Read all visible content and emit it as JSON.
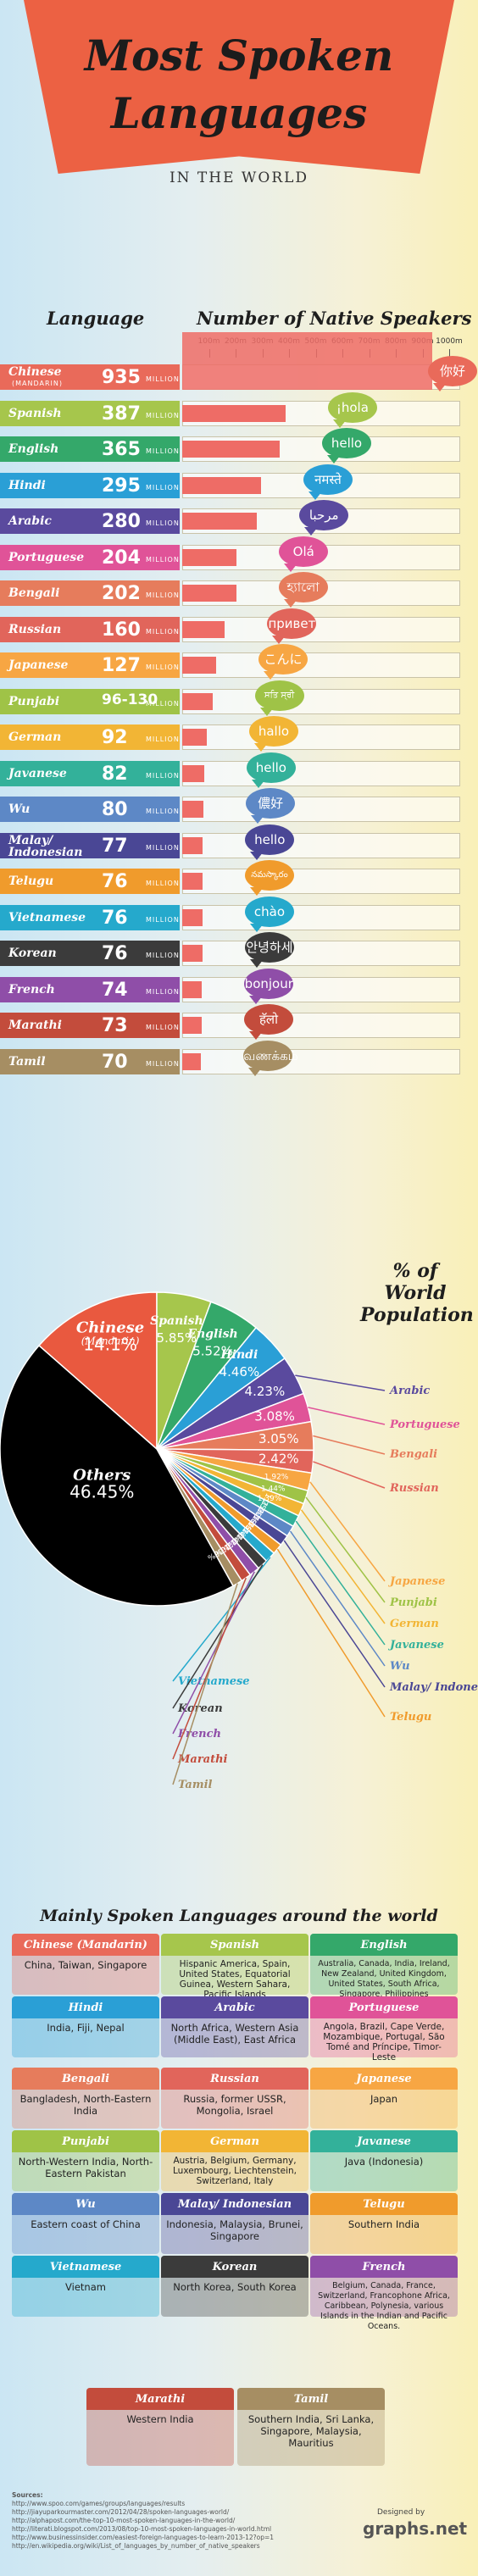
{
  "header": {
    "title_line1": "Most Spoken",
    "title_line2": "Languages",
    "subtitle": "IN THE WORLD",
    "col_language": "Language",
    "col_speakers": "Number of Native Speakers"
  },
  "colors": {
    "banner": "#ec6143",
    "bar": "#ee6c66",
    "pie_others": "#000000"
  },
  "chart_data": [
    {
      "type": "bar",
      "title": "Number of Native Speakers",
      "unit": "MILLION",
      "ticks": [
        "100m",
        "200m",
        "300m",
        "400m",
        "500m",
        "600m",
        "700m",
        "800m",
        "900m",
        "1000m"
      ],
      "xlim": [
        0,
        1000
      ],
      "categories": [
        "Chinese (MANDARIN)",
        "Spanish",
        "English",
        "Hindi",
        "Arabic",
        "Portuguese",
        "Bengali",
        "Russian",
        "Japanese",
        "Punjabi",
        "German",
        "Javanese",
        "Wu",
        "Malay/ Indonesian",
        "Telugu",
        "Vietnamese",
        "Korean",
        "French",
        "Marathi",
        "Tamil"
      ],
      "labels": [
        "935",
        "387",
        "365",
        "295",
        "280",
        "204",
        "202",
        "160",
        "127",
        "96-130",
        "92",
        "82",
        "80",
        "77",
        "76",
        "76",
        "76",
        "74",
        "73",
        "70"
      ],
      "values": [
        935,
        387,
        365,
        295,
        280,
        204,
        202,
        160,
        127,
        113,
        92,
        82,
        80,
        77,
        76,
        76,
        76,
        74,
        73,
        70
      ],
      "row_colors": [
        "#e96a5a",
        "#a6c64c",
        "#34a86a",
        "#2a9fd6",
        "#5a4a9e",
        "#e05398",
        "#e67c5c",
        "#e1655b",
        "#f7a643",
        "#9fc347",
        "#f2b535",
        "#33b19a",
        "#5d88c6",
        "#4a4795",
        "#f09b2c",
        "#25a9cc",
        "#3b3b3b",
        "#8f4ea8",
        "#c34c3c",
        "#a68e63"
      ],
      "greetings": [
        "你好",
        "¡hola",
        "hello",
        "नमस्ते",
        "مرحبا",
        "Olá",
        "হ্যালো",
        "привет",
        "こんにちは",
        "ਸਤਿ ਸ੍ਰੀ ਅਕਾਲ",
        "hallo",
        "hello",
        "儂好",
        "hello",
        "నమస్కారం",
        "chào",
        "안녕하세요",
        "bonjour",
        "हॅलो",
        "வணக்கம்"
      ],
      "bubble_colors": [
        "#e96a5a",
        "#a6c64c",
        "#34a86a",
        "#2a9fd6",
        "#5a4a9e",
        "#e05398",
        "#e67c5c",
        "#e1655b",
        "#f7a643",
        "#9fc347",
        "#f2b535",
        "#33b19a",
        "#5d88c6",
        "#4a4795",
        "#f09b2c",
        "#25a9cc",
        "#3b3b3b",
        "#8f4ea8",
        "#c34c3c",
        "#a68e63"
      ]
    },
    {
      "type": "pie",
      "title": "% of World Population",
      "slices": [
        {
          "name": "Chinese (Mandarin)",
          "pct": "14.1%",
          "value": 14.1,
          "color": "#e9593f"
        },
        {
          "name": "Spanish",
          "pct": "5.85%",
          "value": 5.85,
          "color": "#a6c64c"
        },
        {
          "name": "English",
          "pct": "5.52%",
          "value": 5.52,
          "color": "#34a86a"
        },
        {
          "name": "Hindi",
          "pct": "4.46%",
          "value": 4.46,
          "color": "#2a9fd6"
        },
        {
          "name": "Arabic",
          "pct": "4.23%",
          "value": 4.23,
          "color": "#5a4a9e"
        },
        {
          "name": "Portuguese",
          "pct": "3.08%",
          "value": 3.08,
          "color": "#e05398"
        },
        {
          "name": "Bengali",
          "pct": "3.05%",
          "value": 3.05,
          "color": "#e67c5c"
        },
        {
          "name": "Russian",
          "pct": "2.42%",
          "value": 2.42,
          "color": "#e1655b"
        },
        {
          "name": "Japanese",
          "pct": "1.92%",
          "value": 1.92,
          "color": "#f7a643"
        },
        {
          "name": "Punjabi",
          "pct": "1.44%",
          "value": 1.44,
          "color": "#9fc347"
        },
        {
          "name": "German",
          "pct": "1.39%",
          "value": 1.39,
          "color": "#f2b535"
        },
        {
          "name": "Javanese",
          "pct": "1.25%",
          "value": 1.25,
          "color": "#33b19a"
        },
        {
          "name": "Wu",
          "pct": "1.20%",
          "value": 1.2,
          "color": "#5d88c6"
        },
        {
          "name": "Malay/ Indonesian",
          "pct": "1.16%",
          "value": 1.16,
          "color": "#4a4795"
        },
        {
          "name": "Telugu",
          "pct": "1.15%",
          "value": 1.15,
          "color": "#f09b2c"
        },
        {
          "name": "Vietnamese",
          "pct": "1.14%",
          "value": 1.14,
          "color": "#25a9cc"
        },
        {
          "name": "Korean",
          "pct": "1.14%",
          "value": 1.14,
          "color": "#3b3b3b"
        },
        {
          "name": "French",
          "pct": "1.12%",
          "value": 1.12,
          "color": "#8f4ea8"
        },
        {
          "name": "Marathi",
          "pct": "1.10%",
          "value": 1.1,
          "color": "#c34c3c"
        },
        {
          "name": "Tamil",
          "pct": "1.06%",
          "value": 1.06,
          "color": "#a68e63"
        },
        {
          "name": "Others",
          "pct": "46.45%",
          "value": 46.45,
          "color": "#000000"
        }
      ]
    }
  ],
  "regions": {
    "title": "Mainly Spoken Languages around the world",
    "cards": [
      {
        "name": "Chinese (Mandarin)",
        "text": "China, Taiwan, Singapore",
        "color": "#e96a5a"
      },
      {
        "name": "Spanish",
        "text": "Hispanic America, Spain, United States, Equatorial Guinea, Western Sahara, Pacific Islands",
        "color": "#a6c64c"
      },
      {
        "name": "English",
        "text": "Australia, Canada, India, Ireland, New Zealand, United Kingdom, United States, South Africa, Singapore, Philippines",
        "color": "#34a86a"
      },
      {
        "name": "Hindi",
        "text": "India, Fiji, Nepal",
        "color": "#2a9fd6"
      },
      {
        "name": "Arabic",
        "text": "North Africa, Western Asia (Middle East), East Africa",
        "color": "#5a4a9e"
      },
      {
        "name": "Portuguese",
        "text": "Angola, Brazil, Cape Verde, Mozambique, Portugal, São Tomé and Príncipe, Timor-Leste",
        "color": "#e05398"
      },
      {
        "name": "Bengali",
        "text": "Bangladesh, North-Eastern India",
        "color": "#e67c5c"
      },
      {
        "name": "Russian",
        "text": "Russia, former USSR, Mongolia, Israel",
        "color": "#e1655b"
      },
      {
        "name": "Japanese",
        "text": "Japan",
        "color": "#f7a643"
      },
      {
        "name": "Punjabi",
        "text": "North-Western India, North-Eastern Pakistan",
        "color": "#9fc347"
      },
      {
        "name": "German",
        "text": "Austria, Belgium, Germany, Luxembourg, Liechtenstein, Switzerland, Italy",
        "color": "#f2b535"
      },
      {
        "name": "Javanese",
        "text": "Java (Indonesia)",
        "color": "#33b19a"
      },
      {
        "name": "Wu",
        "text": "Eastern coast of China",
        "color": "#5d88c6"
      },
      {
        "name": "Malay/ Indonesian",
        "text": "Indonesia, Malaysia, Brunei, Singapore",
        "color": "#4a4795"
      },
      {
        "name": "Telugu",
        "text": "Southern India",
        "color": "#f09b2c"
      },
      {
        "name": "Vietnamese",
        "text": "Vietnam",
        "color": "#25a9cc"
      },
      {
        "name": "Korean",
        "text": "North Korea, South Korea",
        "color": "#3b3b3b"
      },
      {
        "name": "French",
        "text": "Belgium, Canada, France, Switzerland, Francophone Africa, Caribbean, Polynesia, various Islands in the Indian and Pacific Oceans.",
        "color": "#8f4ea8"
      },
      {
        "name": "Marathi",
        "text": "Western India",
        "color": "#c34c3c"
      },
      {
        "name": "Tamil",
        "text": "Southern India, Sri Lanka, Singapore, Malaysia, Mauritius",
        "color": "#a68e63"
      }
    ]
  },
  "footer": {
    "sources_label": "Sources:",
    "sources": [
      "http://www.spoo.com/games/groups/languages/results",
      "http://jiayuparkourmaster.com/2012/04/28/spoken-languages-world/",
      "http://alphapost.com/the-top-10-most-spoken-languages-in-the-world/",
      "http://literati.blogspot.com/2013/08/top-10-most-spoken-languages-in-world.html",
      "http://www.businessinsider.com/easiest-foreign-languages-to-learn-2013-12?op=1",
      "http://en.wikipedia.org/wiki/List_of_languages_by_number_of_native_speakers"
    ],
    "designed_by": "Designed by",
    "brand": "graphs.net"
  }
}
